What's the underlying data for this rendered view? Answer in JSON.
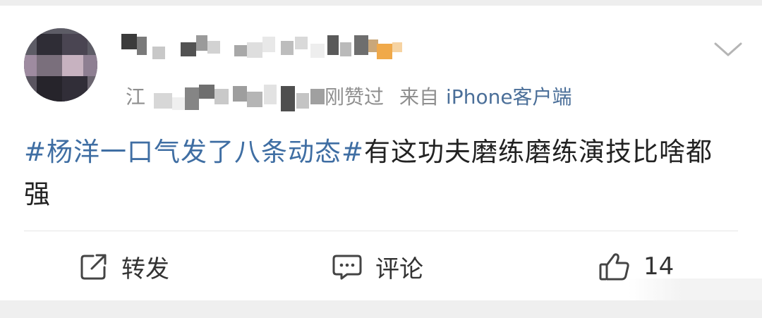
{
  "post": {
    "meta": {
      "location_prefix": "江",
      "liked_suffix": "刚赞过",
      "source_prefix": "来自",
      "client": "iPhone客户端"
    },
    "text": {
      "topic": "#杨洋一口气发了八条动态#",
      "body": "有这功夫磨练磨练演技比啥都强"
    },
    "actions": {
      "repost_label": "转发",
      "comment_label": "评论",
      "like_count": "14"
    }
  },
  "icons": {
    "menu": "chevron-down-icon",
    "repost": "repost-icon",
    "comment": "comment-icon",
    "like": "thumbs-up-icon"
  },
  "colors": {
    "topic_link": "#3f6ea3",
    "client_link": "#4b6f99",
    "meta_text": "#8f8f8f",
    "body_text": "#222222"
  }
}
